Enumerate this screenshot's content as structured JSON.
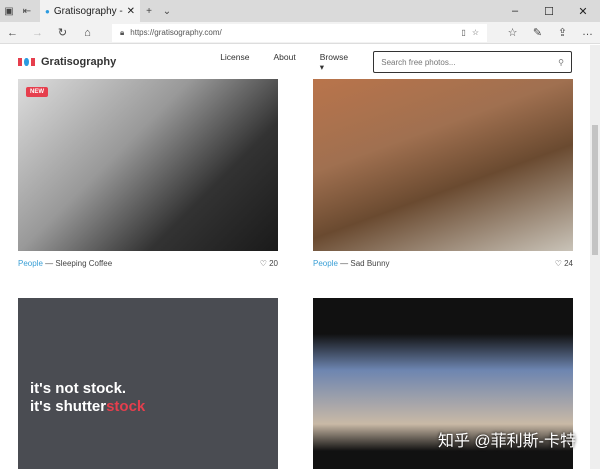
{
  "browser": {
    "tab_title": "Gratisography - Free Hi",
    "url": "https://gratisography.com/"
  },
  "site": {
    "brand": "Gratisography",
    "nav": [
      "License",
      "About",
      "Browse ▾"
    ],
    "search_placeholder": "Search free photos..."
  },
  "cards": [
    {
      "category": "People",
      "title": "— Sleeping Coffee",
      "likes": "20",
      "badge": "NEW"
    },
    {
      "category": "People",
      "title": "— Sad Bunny",
      "likes": "24"
    }
  ],
  "ad": {
    "line1": "it's not stock.",
    "line2a": "it's shutter",
    "line2b": "stock"
  },
  "watermark": "知乎 @菲利斯-卡特"
}
